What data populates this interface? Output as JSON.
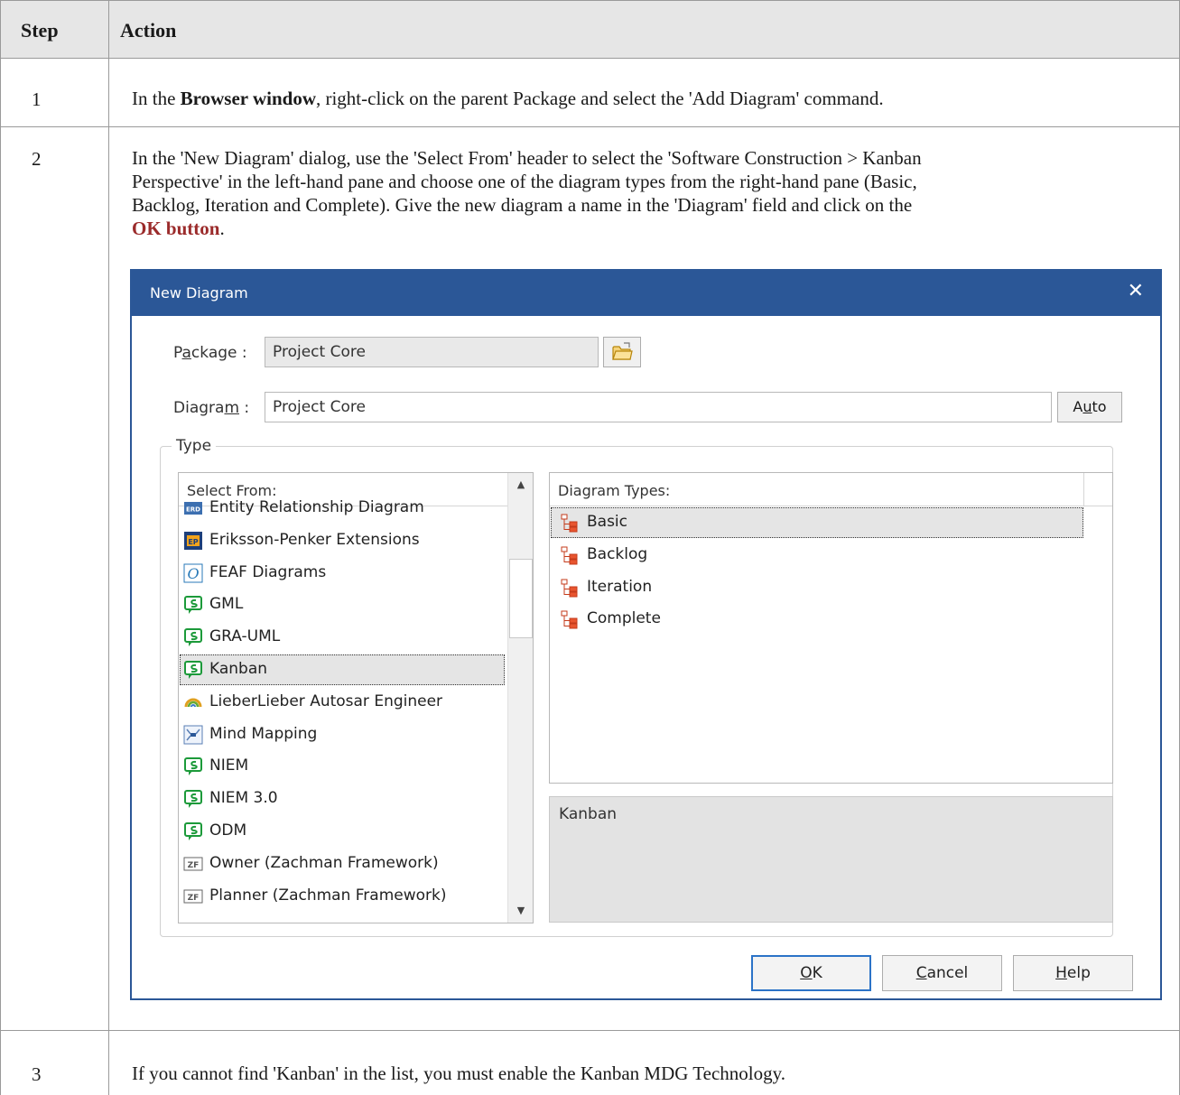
{
  "table": {
    "header": {
      "step": "Step",
      "action": "Action"
    },
    "rows": [
      {
        "step": "1",
        "pre": "In the ",
        "bold": "Browser window",
        "post": ", right-click on the parent Package and select the 'Add Diagram' command."
      },
      {
        "step": "2",
        "line1": "In the 'New Diagram' dialog, use the 'Select From' header to select the 'Software Construction > Kanban",
        "line2": "Perspective' in the left-hand pane and choose one of the diagram types from the right-hand pane (Basic,",
        "line3": "Backlog, Iteration and Complete). Give the new diagram a name in the 'Diagram' field and click on the",
        "ok_ref": "OK button",
        "ok_suffix": "."
      },
      {
        "step": "3",
        "text": "If you cannot find 'Kanban' in the list, you must enable the Kanban MDG Technology."
      }
    ]
  },
  "dialog": {
    "title": "New Diagram",
    "close_glyph": "✕",
    "package_label_pre": "P",
    "package_label_u": "a",
    "package_label_post": "ckage :",
    "package_value": "Project Core",
    "diagram_label_pre": "Diagra",
    "diagram_label_u": "m",
    "diagram_label_post": " :",
    "diagram_value": "Project Core",
    "auto_pre": "A",
    "auto_u": "u",
    "auto_post": "to",
    "type_group": "Type",
    "select_from_header": "Select From:",
    "select_from_items": [
      {
        "label": "Entity Relationship Diagram",
        "icon": "erd-icon"
      },
      {
        "label": "Eriksson-Penker Extensions",
        "icon": "ep-icon"
      },
      {
        "label": "FEAF Diagrams",
        "icon": "feaf-icon"
      },
      {
        "label": "GML",
        "icon": "mdg-icon"
      },
      {
        "label": "GRA-UML",
        "icon": "mdg-icon"
      },
      {
        "label": "Kanban",
        "icon": "mdg-icon",
        "selected": true
      },
      {
        "label": "LieberLieber Autosar Engineer",
        "icon": "lieberlieber-icon"
      },
      {
        "label": "Mind Mapping",
        "icon": "mindmap-icon"
      },
      {
        "label": "NIEM",
        "icon": "mdg-icon"
      },
      {
        "label": "NIEM 3.0",
        "icon": "mdg-icon"
      },
      {
        "label": "ODM",
        "icon": "mdg-icon"
      },
      {
        "label": "Owner (Zachman Framework)",
        "icon": "zachman-icon"
      },
      {
        "label": "Planner (Zachman Framework)",
        "icon": "zachman-icon"
      }
    ],
    "diagram_types_header": "Diagram Types:",
    "diagram_types": [
      {
        "label": "Basic",
        "selected": true
      },
      {
        "label": "Backlog"
      },
      {
        "label": "Iteration"
      },
      {
        "label": "Complete"
      }
    ],
    "description": "Kanban",
    "ok_u": "O",
    "ok_post": "K",
    "cancel_u": "C",
    "cancel_post": "ancel",
    "help_u": "H",
    "help_post": "elp"
  }
}
